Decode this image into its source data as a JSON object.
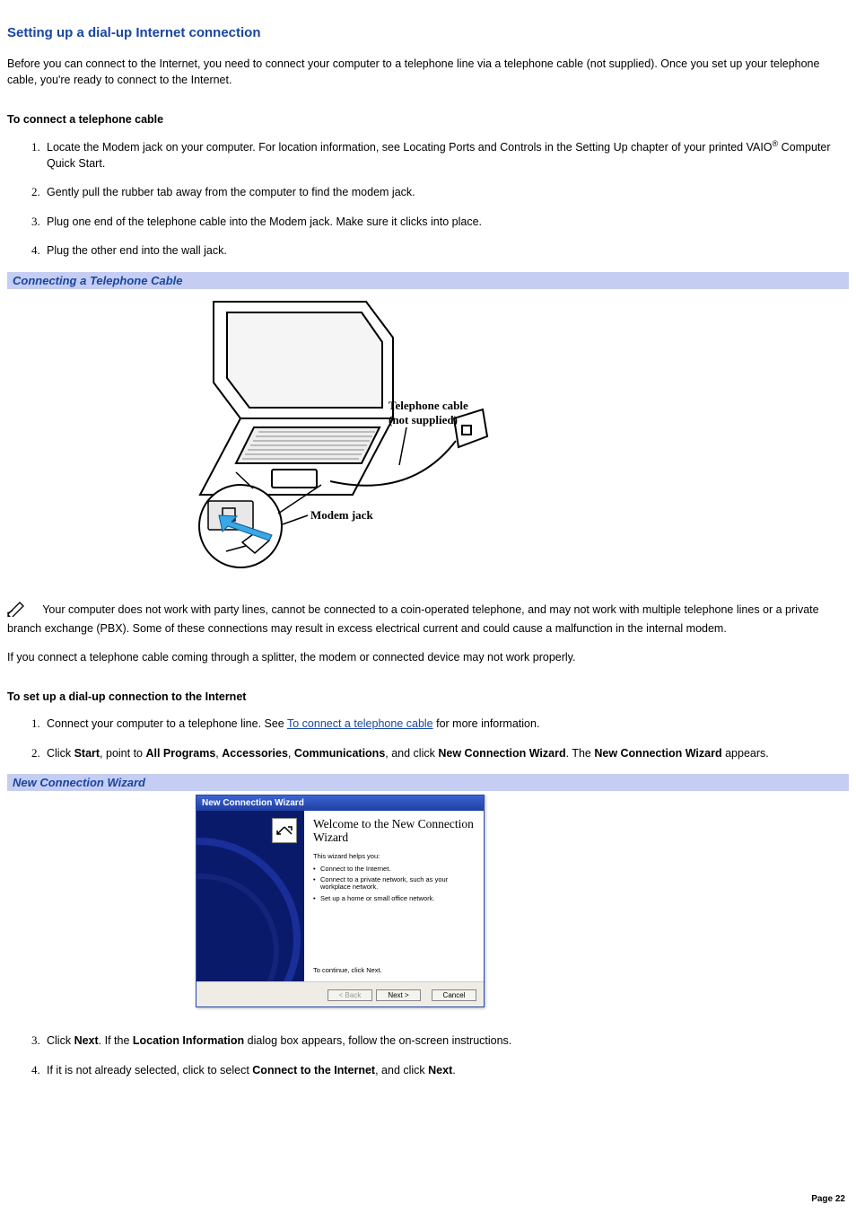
{
  "title": "Setting up a dial-up Internet connection",
  "intro": "Before you can connect to the Internet, you need to connect your computer to a telephone line via a telephone cable (not supplied). Once you set up your telephone cable, you're ready to connect to the Internet.",
  "sub1": "To connect a telephone cable",
  "list1": {
    "i1a": "Locate the Modem jack on your computer. For location information, see Locating Ports and Controls in the Setting Up chapter of your printed VAIO",
    "i1b": " Computer Quick Start.",
    "i2": "Gently pull the rubber tab away from the computer to find the modem jack.",
    "i3": "Plug one end of the telephone cable into the Modem jack. Make sure it clicks into place.",
    "i4": "Plug the other end into the wall jack."
  },
  "caption1": "Connecting a Telephone Cable",
  "fig1": {
    "cable_label_line1": "Telephone cable",
    "cable_label_line2": "(not supplied)",
    "jack_label": "Modem jack"
  },
  "note1": " Your computer does not work with party lines, cannot be connected to a coin-operated telephone, and may not work with multiple telephone lines or a private branch exchange (PBX). Some of these connections may result in excess electrical current and could cause a malfunction in the internal modem.",
  "note2": "If you connect a telephone cable coming through a splitter, the modem or connected device may not work properly.",
  "sub2": "To set up a dial-up connection to the Internet",
  "list2": {
    "i1a": "Connect your computer to a telephone line. See ",
    "i1link": "To connect a telephone cable",
    "i1b": " for more information.",
    "i2a": "Click ",
    "i2_start": "Start",
    "i2b": ", point to ",
    "i2_allprograms": "All Programs",
    "i2c": ", ",
    "i2_accessories": "Accessories",
    "i2d": ", ",
    "i2_communications": "Communications",
    "i2e": ", and click ",
    "i2_ncw": "New Connection Wizard",
    "i2f": ". The ",
    "i2_ncw2": "New Connection Wizard",
    "i2g": " appears.",
    "i3a": "Click ",
    "i3_next": "Next",
    "i3b": ". If the ",
    "i3_loc": "Location Information",
    "i3c": " dialog box appears, follow the on-screen instructions.",
    "i4a": "If it is not already selected, click to select ",
    "i4_conn": "Connect to the Internet",
    "i4b": ", and click ",
    "i4_next": "Next",
    "i4c": "."
  },
  "caption2": "New Connection Wizard",
  "wizard": {
    "titlebar": "New Connection Wizard",
    "heading": "Welcome to the New Connection Wizard",
    "sub": "This wizard helps you:",
    "b1": "Connect to the Internet.",
    "b2": "Connect to a private network, such as your workplace network.",
    "b3": "Set up a home or small office network.",
    "continue": "To continue, click Next.",
    "back": "< Back",
    "next": "Next >",
    "cancel": "Cancel"
  },
  "page": "Page 22",
  "reg": "®"
}
